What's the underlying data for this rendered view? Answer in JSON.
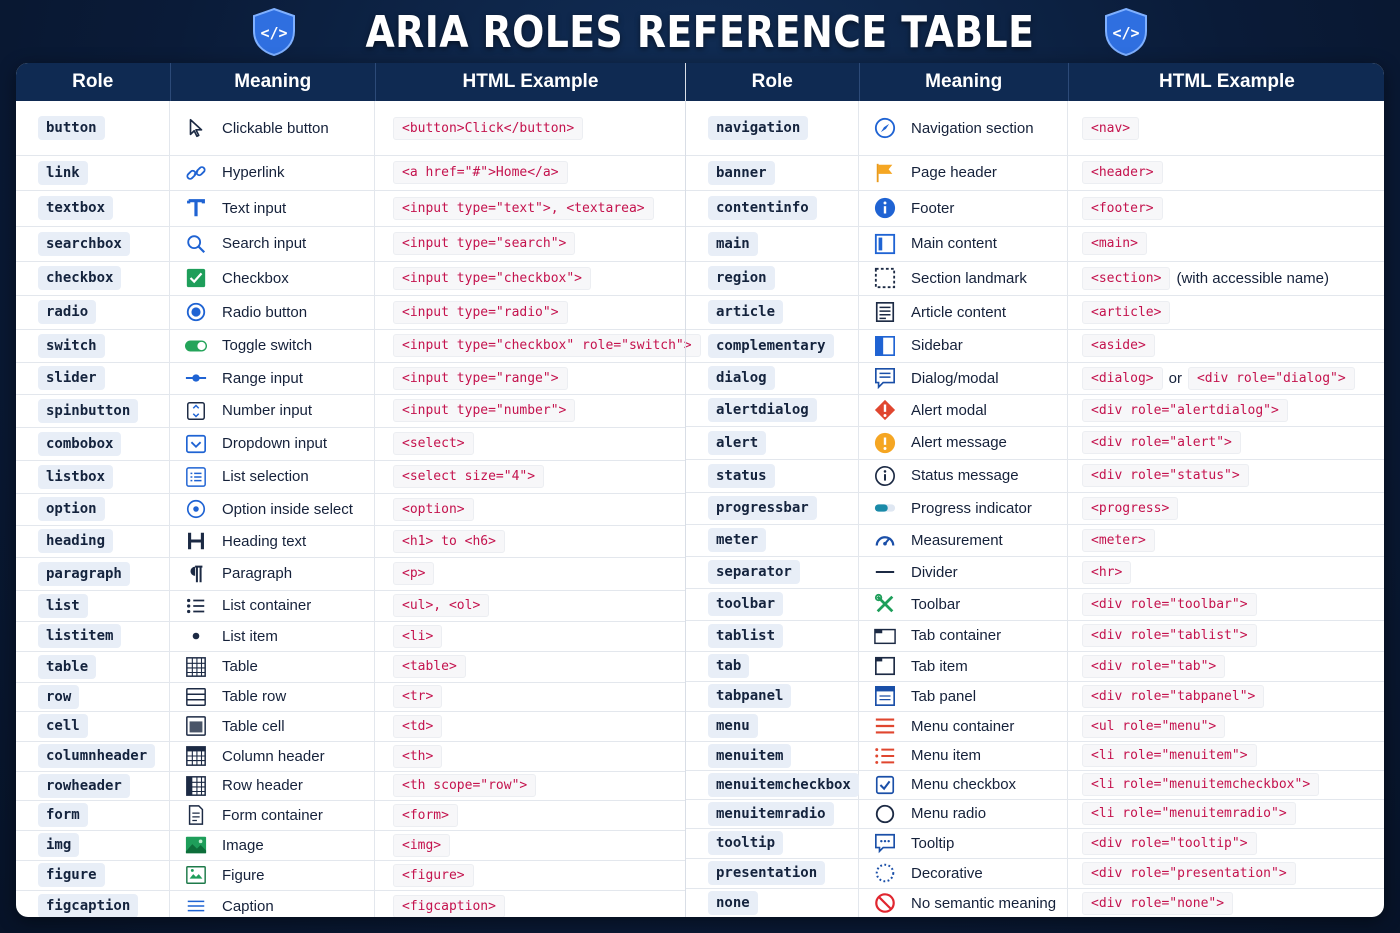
{
  "title": "ARIA ROLES REFERENCE TABLE",
  "headers": {
    "role": "Role",
    "meaning": "Meaning",
    "example": "HTML Example"
  },
  "left": [
    {
      "role": "button",
      "icon": "cursor-icon",
      "meaning": "Clickable button",
      "code": [
        "<button>Click</button>"
      ]
    },
    {
      "role": "link",
      "icon": "link-icon",
      "meaning": "Hyperlink",
      "code": [
        "<a href=\"#\">Home</a>"
      ]
    },
    {
      "role": "textbox",
      "icon": "text-t-icon",
      "meaning": "Text input",
      "code": [
        "<input type=\"text\">, <textarea>"
      ]
    },
    {
      "role": "searchbox",
      "icon": "search-icon",
      "meaning": "Search input",
      "code": [
        "<input type=\"search\">"
      ]
    },
    {
      "role": "checkbox",
      "icon": "checkbox-checked-icon",
      "meaning": "Checkbox",
      "code": [
        "<input type=\"checkbox\">"
      ]
    },
    {
      "role": "radio",
      "icon": "radio-icon",
      "meaning": "Radio button",
      "code": [
        "<input type=\"radio\">"
      ]
    },
    {
      "role": "switch",
      "icon": "toggle-icon",
      "meaning": "Toggle switch",
      "code": [
        "<input type=\"checkbox\" role=\"switch\">"
      ]
    },
    {
      "role": "slider",
      "icon": "slider-icon",
      "meaning": "Range input",
      "code": [
        "<input type=\"range\">"
      ]
    },
    {
      "role": "spinbutton",
      "icon": "spinner-icon",
      "meaning": "Number input",
      "code": [
        "<input type=\"number\">"
      ]
    },
    {
      "role": "combobox",
      "icon": "dropdown-icon",
      "meaning": "Dropdown input",
      "code": [
        "<select>"
      ]
    },
    {
      "role": "listbox",
      "icon": "listbox-icon",
      "meaning": "List selection",
      "code": [
        "<select size=\"4\">"
      ]
    },
    {
      "role": "option",
      "icon": "option-icon",
      "meaning": "Option inside select",
      "code": [
        "<option>"
      ]
    },
    {
      "role": "heading",
      "icon": "heading-h-icon",
      "meaning": "Heading text",
      "code": [
        "<h1> to <h6>"
      ]
    },
    {
      "role": "paragraph",
      "icon": "pilcrow-icon",
      "meaning": "Paragraph",
      "code": [
        "<p>"
      ]
    },
    {
      "role": "list",
      "icon": "list-icon",
      "meaning": "List container",
      "code": [
        "<ul>, <ol>"
      ]
    },
    {
      "role": "listitem",
      "icon": "bullet-icon",
      "meaning": "List item",
      "code": [
        "<li>"
      ]
    },
    {
      "role": "table",
      "icon": "table-icon",
      "meaning": "Table",
      "code": [
        "<table>"
      ]
    },
    {
      "role": "row",
      "icon": "table-row-icon",
      "meaning": "Table row",
      "code": [
        "<tr>"
      ]
    },
    {
      "role": "cell",
      "icon": "table-cell-icon",
      "meaning": "Table cell",
      "code": [
        "<td>"
      ]
    },
    {
      "role": "columnheader",
      "icon": "column-header-icon",
      "meaning": "Column header",
      "code": [
        "<th>"
      ]
    },
    {
      "role": "rowheader",
      "icon": "row-header-icon",
      "meaning": "Row header",
      "code": [
        "<th scope=\"row\">"
      ]
    },
    {
      "role": "form",
      "icon": "form-icon",
      "meaning": "Form container",
      "code": [
        "<form>"
      ]
    },
    {
      "role": "img",
      "icon": "image-icon",
      "meaning": "Image",
      "code": [
        "<img>"
      ]
    },
    {
      "role": "figure",
      "icon": "figure-icon",
      "meaning": "Figure",
      "code": [
        "<figure>"
      ]
    },
    {
      "role": "figcaption",
      "icon": "caption-icon",
      "meaning": "Caption",
      "code": [
        "<figcaption>"
      ]
    }
  ],
  "right": [
    {
      "role": "navigation",
      "icon": "compass-icon",
      "meaning": "Navigation section",
      "code": [
        "<nav>"
      ]
    },
    {
      "role": "banner",
      "icon": "flag-icon",
      "meaning": "Page header",
      "code": [
        "<header>"
      ]
    },
    {
      "role": "contentinfo",
      "icon": "info-icon",
      "meaning": "Footer",
      "code": [
        "<footer>"
      ]
    },
    {
      "role": "main",
      "icon": "main-frame-icon",
      "meaning": "Main content",
      "code": [
        "<main>"
      ]
    },
    {
      "role": "region",
      "icon": "dashed-square-icon",
      "meaning": "Section landmark",
      "code": [
        "<section>"
      ],
      "note": "(with accessible name)"
    },
    {
      "role": "article",
      "icon": "article-icon",
      "meaning": "Article content",
      "code": [
        "<article>"
      ]
    },
    {
      "role": "complementary",
      "icon": "sidebar-icon",
      "meaning": "Sidebar",
      "code": [
        "<aside>"
      ]
    },
    {
      "role": "dialog",
      "icon": "dialog-icon",
      "meaning": "Dialog/modal",
      "code": [
        "<dialog>",
        "<div role=\"dialog\">"
      ],
      "joiner": "or"
    },
    {
      "role": "alertdialog",
      "icon": "alert-diamond-icon",
      "meaning": "Alert modal",
      "code": [
        "<div role=\"alertdialog\">"
      ]
    },
    {
      "role": "alert",
      "icon": "alert-circle-icon",
      "meaning": "Alert message",
      "code": [
        "<div role=\"alert\">"
      ]
    },
    {
      "role": "status",
      "icon": "status-info-icon",
      "meaning": "Status message",
      "code": [
        "<div role=\"status\">"
      ]
    },
    {
      "role": "progressbar",
      "icon": "progress-icon",
      "meaning": "Progress indicator",
      "code": [
        "<progress>"
      ]
    },
    {
      "role": "meter",
      "icon": "gauge-icon",
      "meaning": "Measurement",
      "code": [
        "<meter>"
      ]
    },
    {
      "role": "separator",
      "icon": "divider-icon",
      "meaning": "Divider",
      "code": [
        "<hr>"
      ]
    },
    {
      "role": "toolbar",
      "icon": "tools-icon",
      "meaning": "Toolbar",
      "code": [
        "<div role=\"toolbar\">"
      ]
    },
    {
      "role": "tablist",
      "icon": "tablist-icon",
      "meaning": "Tab container",
      "code": [
        "<div role=\"tablist\">"
      ]
    },
    {
      "role": "tab",
      "icon": "tab-icon",
      "meaning": "Tab item",
      "code": [
        "<div role=\"tab\">"
      ]
    },
    {
      "role": "tabpanel",
      "icon": "tabpanel-icon",
      "meaning": "Tab panel",
      "code": [
        "<div role=\"tabpanel\">"
      ]
    },
    {
      "role": "menu",
      "icon": "menu-icon",
      "meaning": "Menu container",
      "code": [
        "<ul role=\"menu\">"
      ]
    },
    {
      "role": "menuitem",
      "icon": "menu-list-icon",
      "meaning": "Menu item",
      "code": [
        "<li role=\"menuitem\">"
      ]
    },
    {
      "role": "menuitemcheckbox",
      "icon": "menu-checkbox-icon",
      "meaning": "Menu checkbox",
      "code": [
        "<li role=\"menuitemcheckbox\">"
      ]
    },
    {
      "role": "menuitemradio",
      "icon": "menu-radio-icon",
      "meaning": "Menu radio",
      "code": [
        "<li role=\"menuitemradio\">"
      ]
    },
    {
      "role": "tooltip",
      "icon": "tooltip-icon",
      "meaning": "Tooltip",
      "code": [
        "<div role=\"tooltip\">"
      ]
    },
    {
      "role": "presentation",
      "icon": "dotted-circle-icon",
      "meaning": "Decorative",
      "code": [
        "<div role=\"presentation\">"
      ]
    },
    {
      "role": "none",
      "icon": "no-symbol-icon",
      "meaning": "No semantic meaning",
      "code": [
        "<div role=\"none\">"
      ]
    }
  ],
  "colors": {
    "header_bg": "#0f2a52",
    "page_bg": "#0a1b38",
    "code_text": "#c4124d",
    "pill_bg": "#e8eef7",
    "accent_blue": "#1f63d3"
  }
}
